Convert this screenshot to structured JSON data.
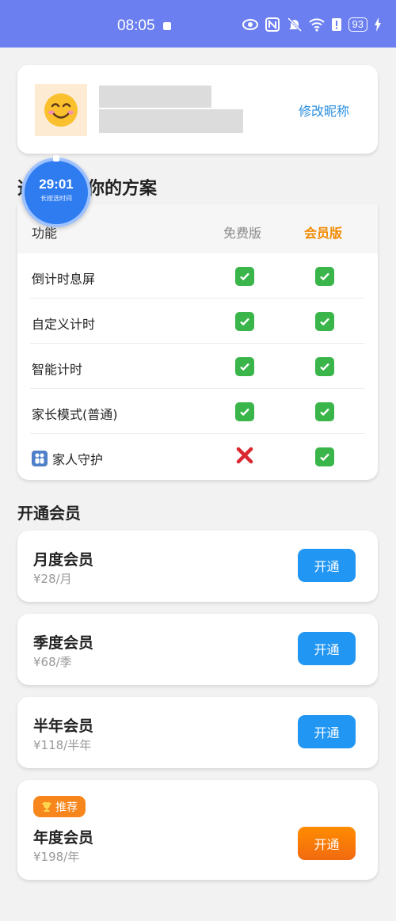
{
  "status_bar": {
    "time": "08:05",
    "battery": "93"
  },
  "profile": {
    "avatar": "smiling-face",
    "edit_label": "修改昵称"
  },
  "plan_section": {
    "title": "选择适合你的方案"
  },
  "timer": {
    "time": "29:01",
    "hint": "长按选时间"
  },
  "compare": {
    "headers": {
      "feature": "功能",
      "free": "免费版",
      "member": "会员版"
    },
    "rows": [
      {
        "label": "倒计时息屏",
        "free": true,
        "member": true
      },
      {
        "label": "自定义计时",
        "free": true,
        "member": true
      },
      {
        "label": "智能计时",
        "free": true,
        "member": true
      },
      {
        "label": "家长模式(普通)",
        "free": true,
        "member": true
      },
      {
        "label": "家人守护",
        "free": false,
        "member": true
      }
    ]
  },
  "vip_section": {
    "title": "开通会员"
  },
  "plans": [
    {
      "name": "月度会员",
      "price": "¥28/月",
      "button": "开通"
    },
    {
      "name": "季度会员",
      "price": "¥68/季",
      "button": "开通"
    },
    {
      "name": "半年会员",
      "price": "¥118/半年",
      "button": "开通"
    },
    {
      "name": "年度会员",
      "price": "¥198/年",
      "button": "开通",
      "badge": "推荐"
    }
  ],
  "colors": {
    "accent": "#2196f3",
    "member": "#f28a00",
    "status_bar": "#6b7ff0"
  }
}
